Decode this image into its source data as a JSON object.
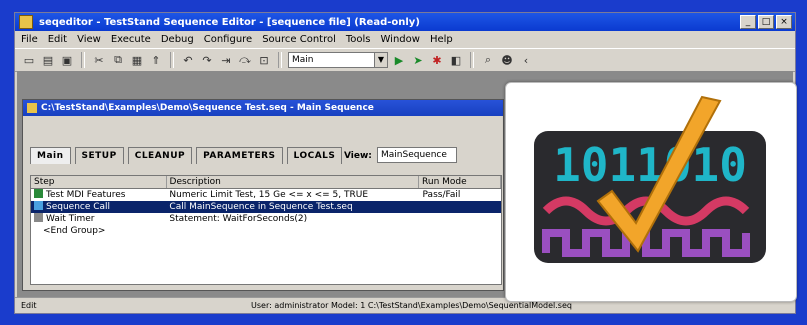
{
  "window": {
    "title": "seqeditor - TestStand Sequence Editor - [sequence file] (Read-only)"
  },
  "menubar": {
    "items": [
      "File",
      "Edit",
      "View",
      "Execute",
      "Debug",
      "Configure",
      "Source Control",
      "Tools",
      "Window",
      "Help"
    ]
  },
  "toolbar": {
    "combo_value": "Main"
  },
  "child_window": {
    "title": "C:\\TestStand\\Examples\\Demo\\Sequence Test.seq - Main Sequence"
  },
  "tabs": {
    "main": "Main",
    "items": [
      "SETUP",
      "CLEANUP",
      "PARAMETERS",
      "LOCALS"
    ]
  },
  "view": {
    "label": "View:",
    "value": "MainSequence"
  },
  "grid": {
    "columns": [
      "Step",
      "Description",
      "Run Mode"
    ],
    "rows": [
      {
        "step": "Test MDI Features",
        "description": "Numeric Limit Test, 15 Ge <= x <= 5, TRUE",
        "mode": "Pass/Fail",
        "selected": false
      },
      {
        "step": "Sequence Call",
        "description": "Call MainSequence in Sequence Test.seq",
        "mode": "",
        "selected": true
      },
      {
        "step": "Wait Timer",
        "description": "Statement: WaitForSeconds(2)",
        "mode": "",
        "selected": false
      },
      {
        "step": "<End Group>",
        "description": "",
        "mode": "",
        "selected": false
      }
    ]
  },
  "statusbar": {
    "left": "Edit",
    "right": "User: administrator    Model: 1    C:\\TestStand\\Examples\\Demo\\SequentialModel.seq"
  },
  "logo": {
    "binary_text": "1011010",
    "colors": {
      "background": "#2a2a2e",
      "digits": "#1fb6c8",
      "wave": "#d43a64",
      "square": "#9a4fc0",
      "check": "#f2a52a"
    }
  },
  "icons": [
    "app-icon",
    "minimize-icon",
    "maximize-icon",
    "close-icon"
  ]
}
